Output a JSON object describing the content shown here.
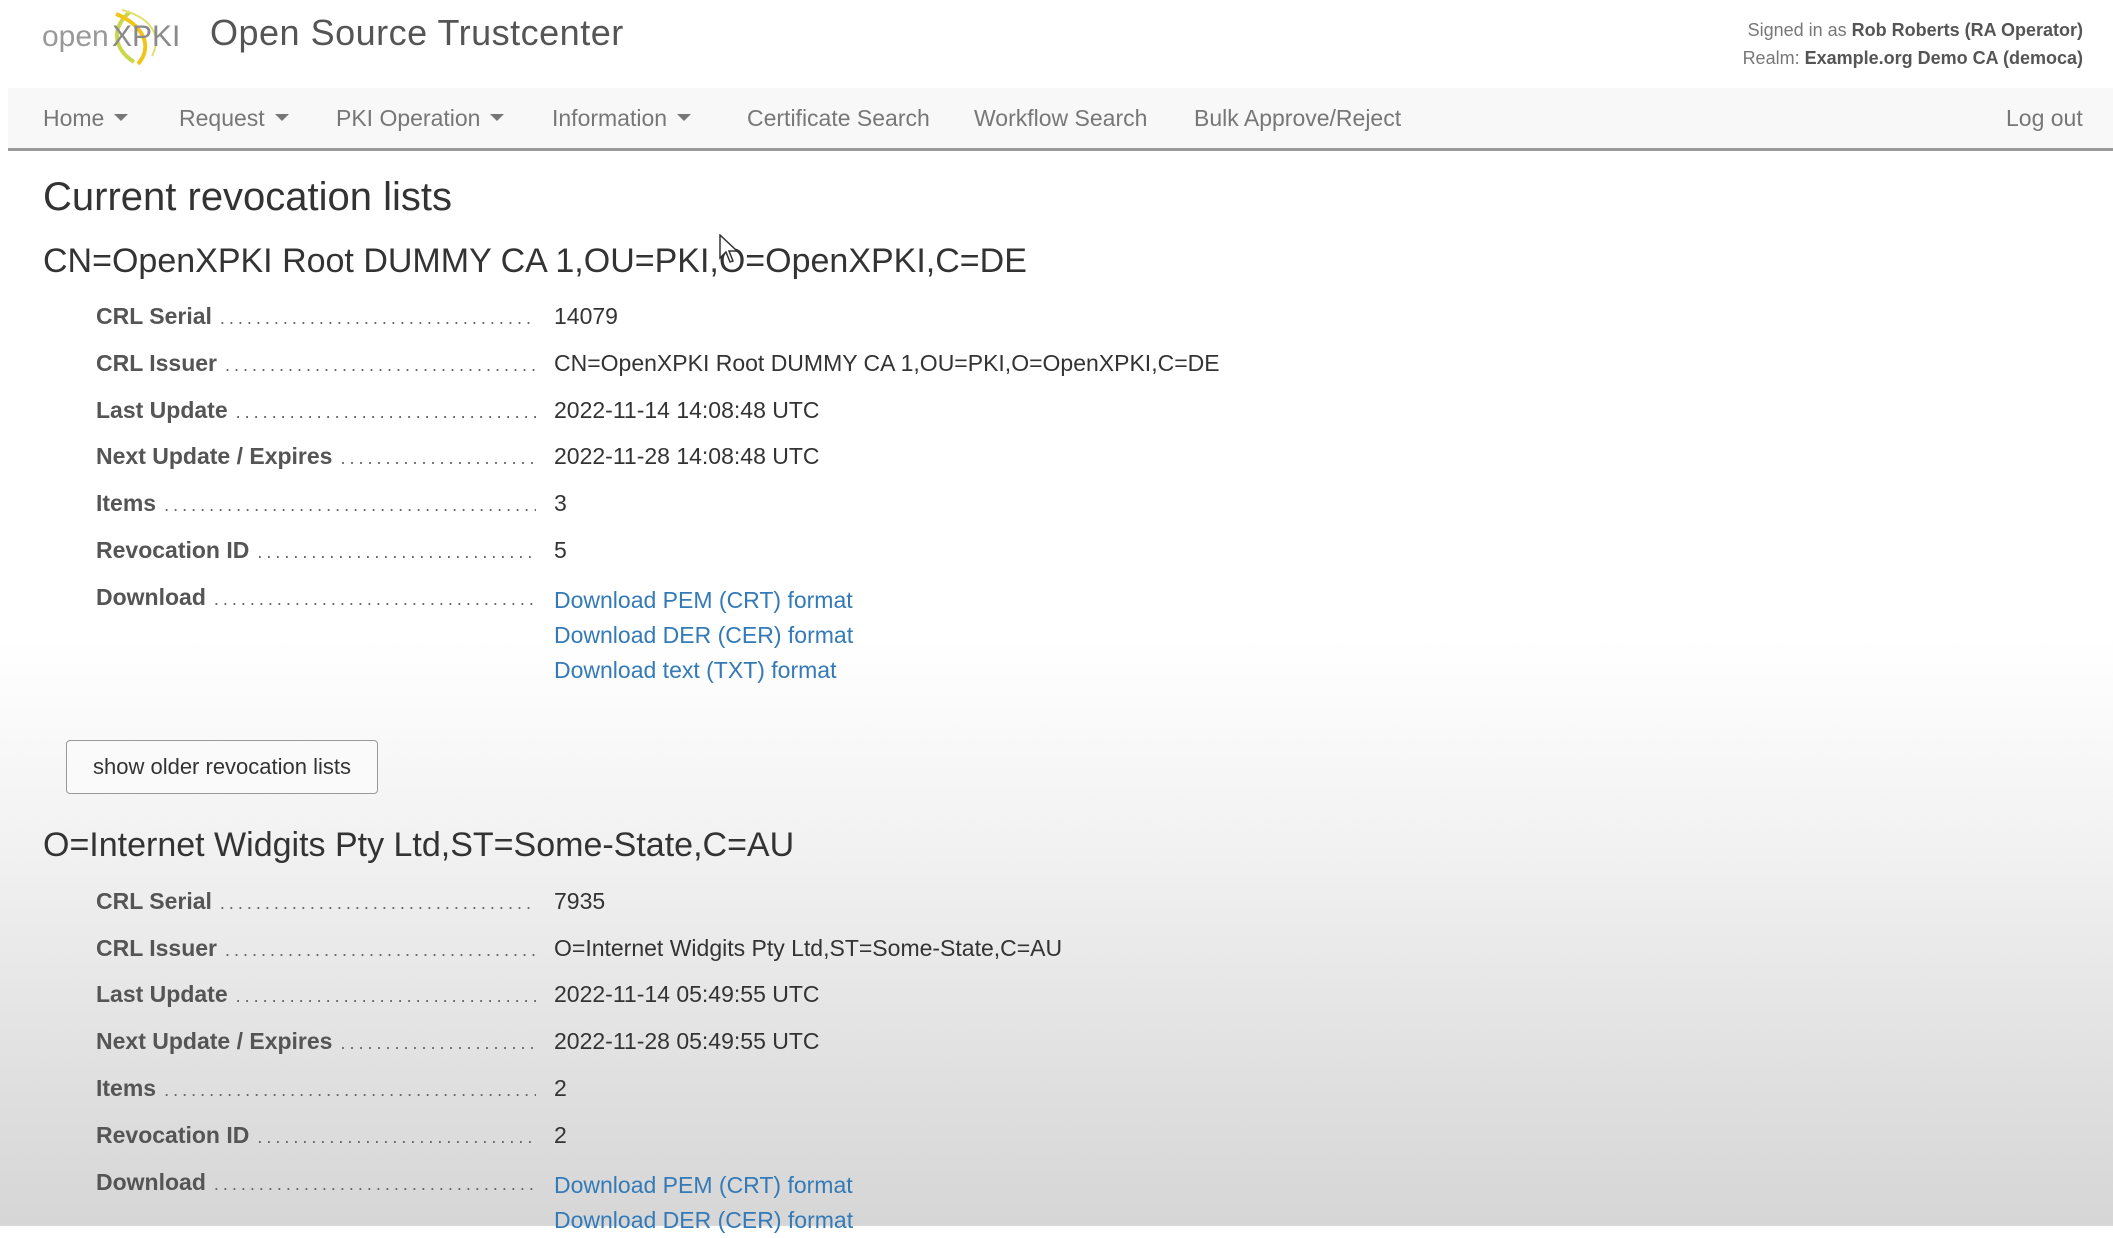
{
  "header": {
    "logo_text": "openXPKI",
    "title": "Open Source Trustcenter",
    "signed_in_label": "Signed in as",
    "signed_in_user": "Rob Roberts (RA Operator)",
    "realm_label": "Realm:",
    "realm_value": "Example.org Demo CA (democa)"
  },
  "nav": {
    "items": [
      {
        "label": "Home",
        "dropdown": true
      },
      {
        "label": "Request",
        "dropdown": true
      },
      {
        "label": "PKI Operation",
        "dropdown": true
      },
      {
        "label": "Information",
        "dropdown": true
      },
      {
        "label": "Certificate Search",
        "dropdown": false
      },
      {
        "label": "Workflow Search",
        "dropdown": false
      },
      {
        "label": "Bulk Approve/Reject",
        "dropdown": false
      }
    ],
    "logout": "Log out"
  },
  "page_title": "Current revocation lists",
  "labels": {
    "crl_serial": "CRL Serial",
    "crl_issuer": "CRL Issuer",
    "last_update": "Last Update",
    "next_update": "Next Update / Expires",
    "items": "Items",
    "revocation_id": "Revocation ID",
    "download": "Download"
  },
  "dots": "......................................................................................",
  "download_links": {
    "pem": "Download PEM (CRT) format",
    "der": "Download DER (CER) format",
    "txt": "Download text (TXT) format"
  },
  "crls": [
    {
      "title": "CN=OpenXPKI Root DUMMY CA 1,OU=PKI,O=OpenXPKI,C=DE",
      "crl_serial": "14079",
      "crl_issuer": "CN=OpenXPKI Root DUMMY CA 1,OU=PKI,O=OpenXPKI,C=DE",
      "last_update": "2022-11-14 14:08:48 UTC",
      "next_update": "2022-11-28 14:08:48 UTC",
      "items": "3",
      "revocation_id": "5"
    },
    {
      "title": "O=Internet Widgits Pty Ltd,ST=Some-State,C=AU",
      "crl_serial": "7935",
      "crl_issuer": "O=Internet Widgits Pty Ltd,ST=Some-State,C=AU",
      "last_update": "2022-11-14 05:49:55 UTC",
      "next_update": "2022-11-28 05:49:55 UTC",
      "items": "2",
      "revocation_id": "2"
    }
  ],
  "older_button": "show older revocation lists",
  "colors": {
    "link": "#337ab7",
    "logo_green": "#9acd32",
    "logo_yellow": "#ffd700",
    "nav_border": "#9a9a9a"
  }
}
